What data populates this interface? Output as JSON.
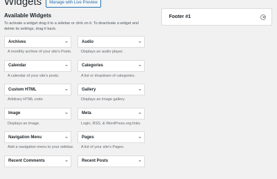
{
  "header": {
    "title": "Widgets",
    "live_preview_label": "Manage with Live Preview"
  },
  "available": {
    "title": "Available Widgets",
    "instructions": "To activate a widget drag it to a sidebar or click on it. To deactivate a widget and delete its settings, drag it back."
  },
  "widgets": [
    {
      "name": "Archives",
      "desc": "A monthly archive of your site's Posts."
    },
    {
      "name": "Audio",
      "desc": "Displays an audio player."
    },
    {
      "name": "Calendar",
      "desc": "A calendar of your site's posts."
    },
    {
      "name": "Categories",
      "desc": "A list or dropdown of categories."
    },
    {
      "name": "Custom HTML",
      "desc": "Arbitrary HTML code."
    },
    {
      "name": "Gallery",
      "desc": "Displays an image gallery."
    },
    {
      "name": "Image",
      "desc": "Displays an image."
    },
    {
      "name": "Meta",
      "desc": "Login, RSS, & WordPress.org links."
    },
    {
      "name": "Navigation Menu",
      "desc": "Add a navigation menu to your sidebar."
    },
    {
      "name": "Pages",
      "desc": "A list of your site's Pages."
    },
    {
      "name": "Recent Comments",
      "desc": ""
    },
    {
      "name": "Recent Posts",
      "desc": ""
    }
  ],
  "sidebar": {
    "title": "Footer #1"
  },
  "colors": {
    "accent": "#2271b1",
    "background": "#f1f1f1"
  }
}
